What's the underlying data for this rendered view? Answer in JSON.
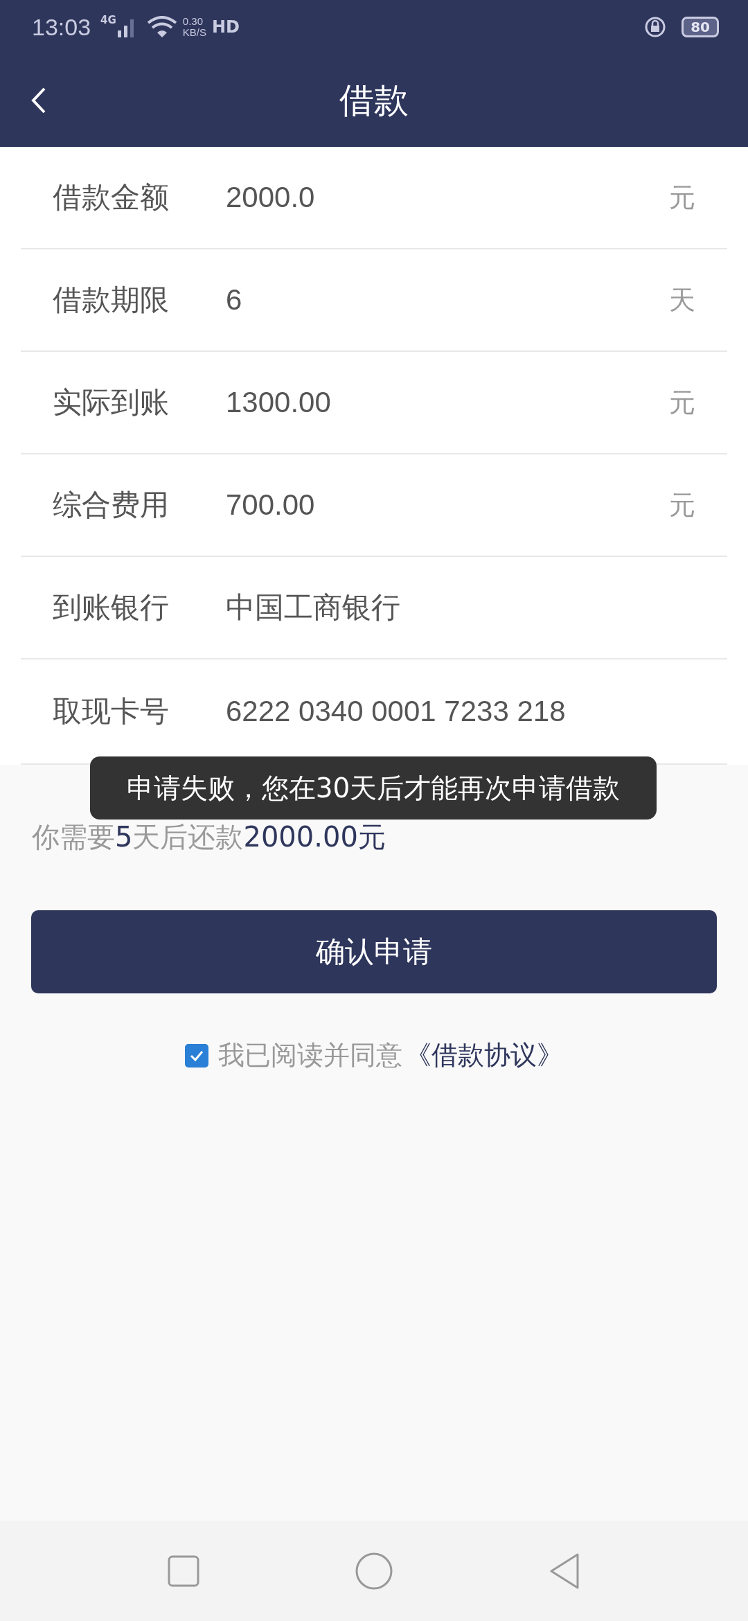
{
  "status_bar": {
    "time": "13:03",
    "network": "4G",
    "speed_value": "0.30",
    "speed_unit": "KB/S",
    "hd": "HD",
    "battery": "80"
  },
  "header": {
    "title": "借款"
  },
  "fields": [
    {
      "label": "借款金额",
      "value": "2000.0",
      "unit": "元"
    },
    {
      "label": "借款期限",
      "value": "6",
      "unit": "天"
    },
    {
      "label": "实际到账",
      "value": "1300.00",
      "unit": "元"
    },
    {
      "label": "综合费用",
      "value": "700.00",
      "unit": "元"
    },
    {
      "label": "到账银行",
      "value": "中国工商银行"
    },
    {
      "label": "取现卡号",
      "value": "6222 0340 0001 7233 218"
    }
  ],
  "repayment_note": [
    {
      "text": "你需要",
      "emphasis": false
    },
    {
      "text": "5",
      "emphasis": true
    },
    {
      "text": "天后还款",
      "emphasis": false
    },
    {
      "text": "2000.00元",
      "emphasis": true
    }
  ],
  "confirm_button": "确认申请",
  "agreement": {
    "checked": true,
    "text": "我已阅读并同意",
    "link": "《借款协议》"
  },
  "toast": "申请失败，您在30天后才能再次申请借款"
}
